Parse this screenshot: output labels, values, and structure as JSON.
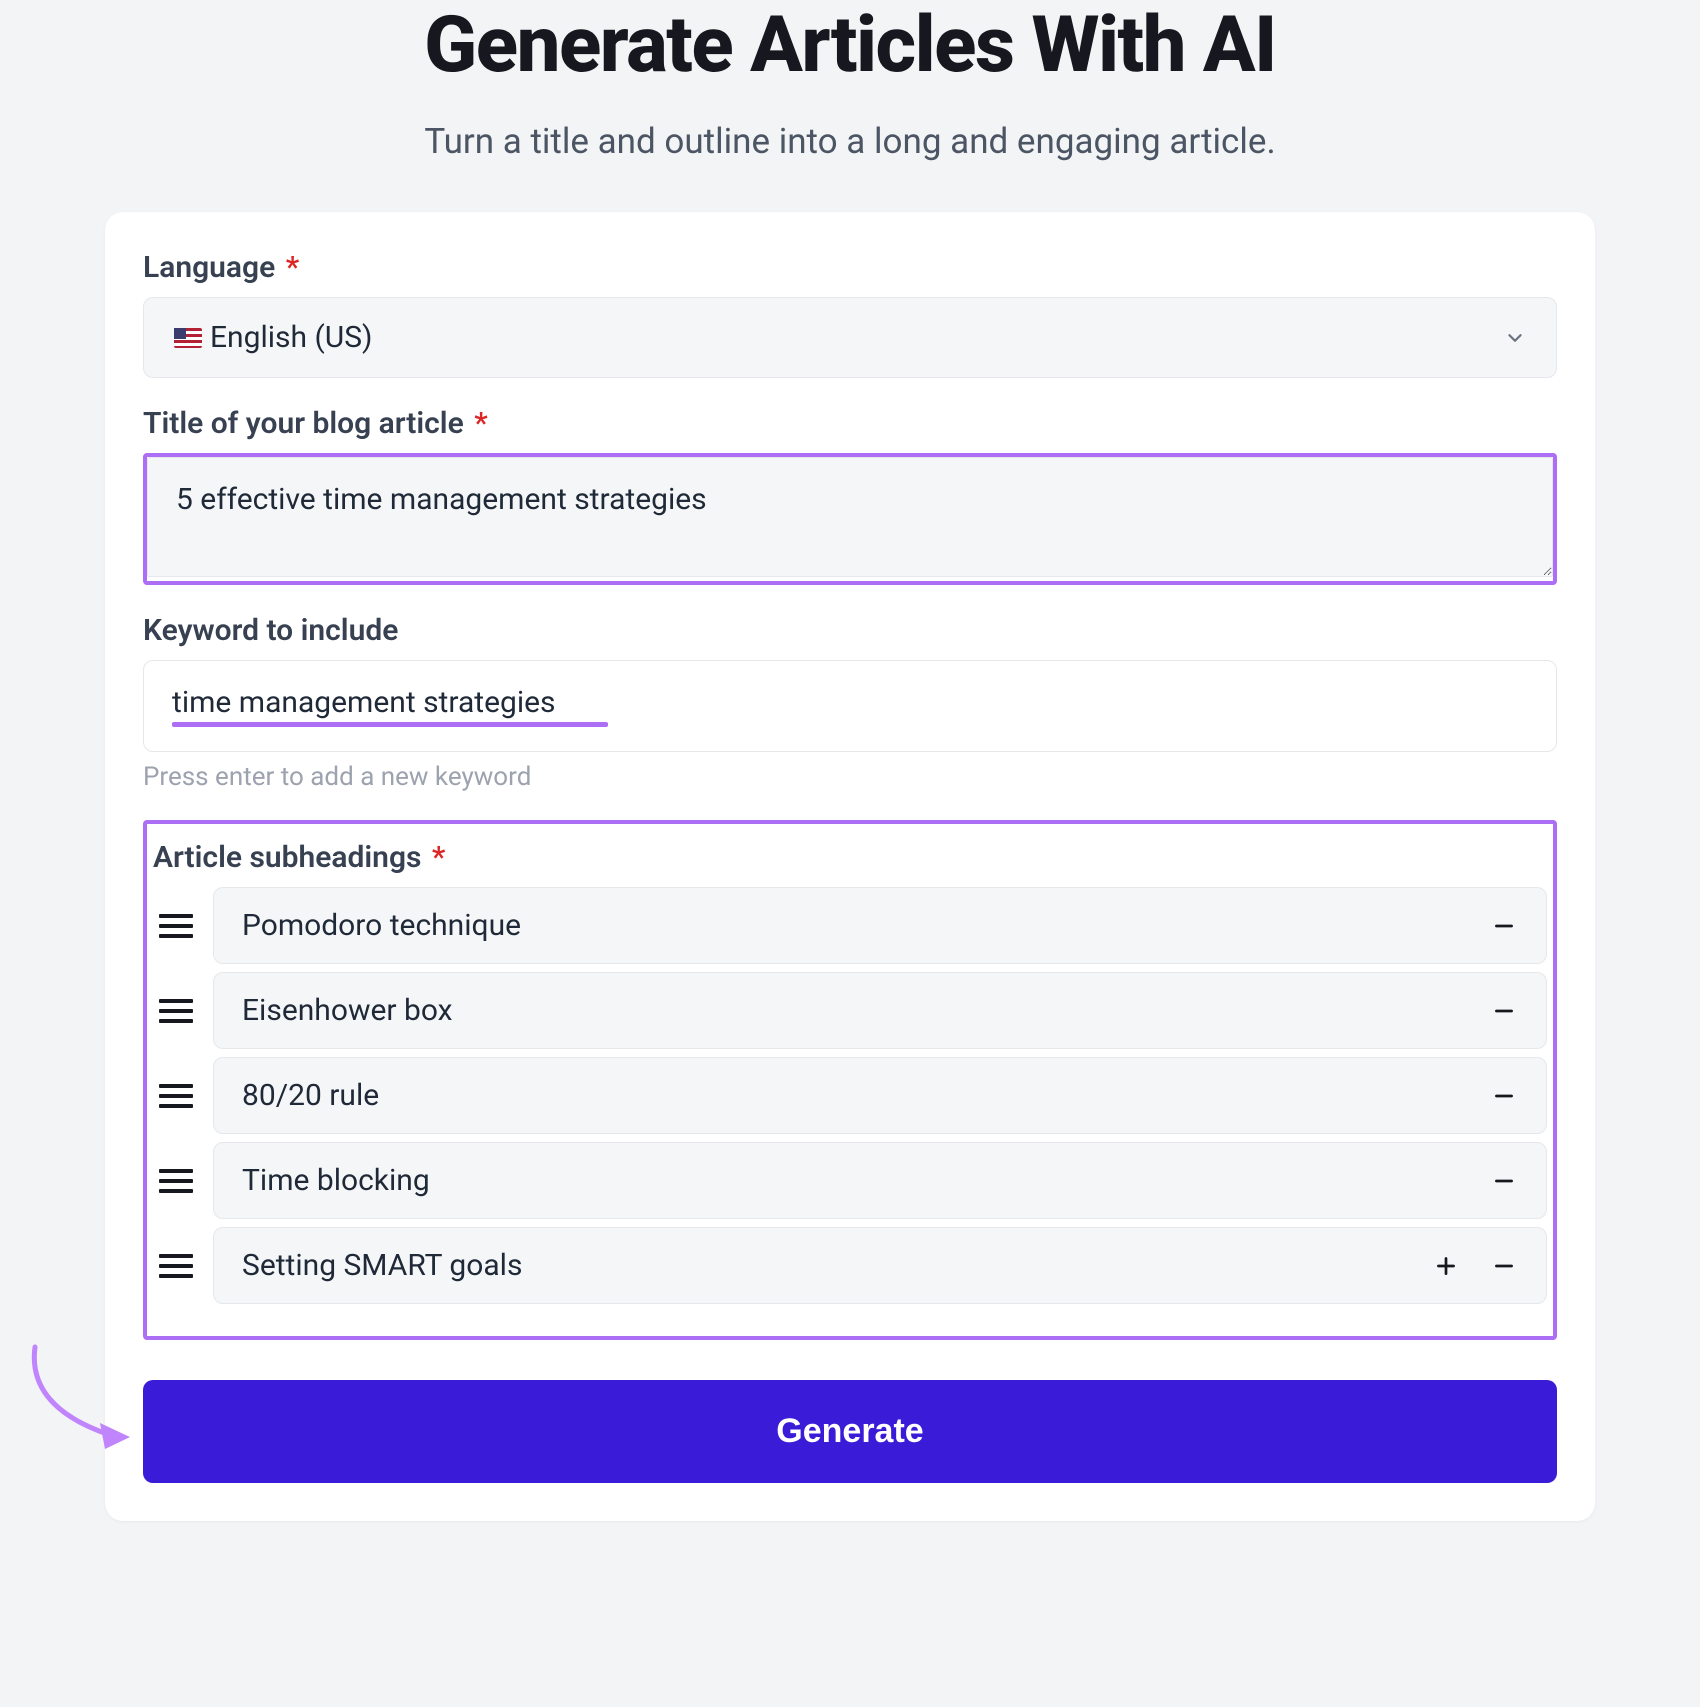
{
  "header": {
    "title": "Generate Articles With AI",
    "subtitle": "Turn a title and outline into a long and engaging article."
  },
  "form": {
    "language": {
      "label": "Language",
      "required": "*",
      "value": "English (US)",
      "flag": "us"
    },
    "title": {
      "label": "Title of your blog article",
      "required": "*",
      "value": "5 effective time management strategies"
    },
    "keyword": {
      "label": "Keyword to include",
      "value": "time management strategies",
      "helper": "Press enter to add a new keyword"
    },
    "subheadings": {
      "label": "Article subheadings",
      "required": "*",
      "items": [
        {
          "text": "Pomodoro technique",
          "showAdd": false
        },
        {
          "text": "Eisenhower box",
          "showAdd": false
        },
        {
          "text": "80/20 rule",
          "showAdd": false
        },
        {
          "text": "Time blocking",
          "showAdd": false
        },
        {
          "text": "Setting SMART goals",
          "showAdd": true
        }
      ]
    },
    "submit": {
      "label": "Generate"
    }
  }
}
